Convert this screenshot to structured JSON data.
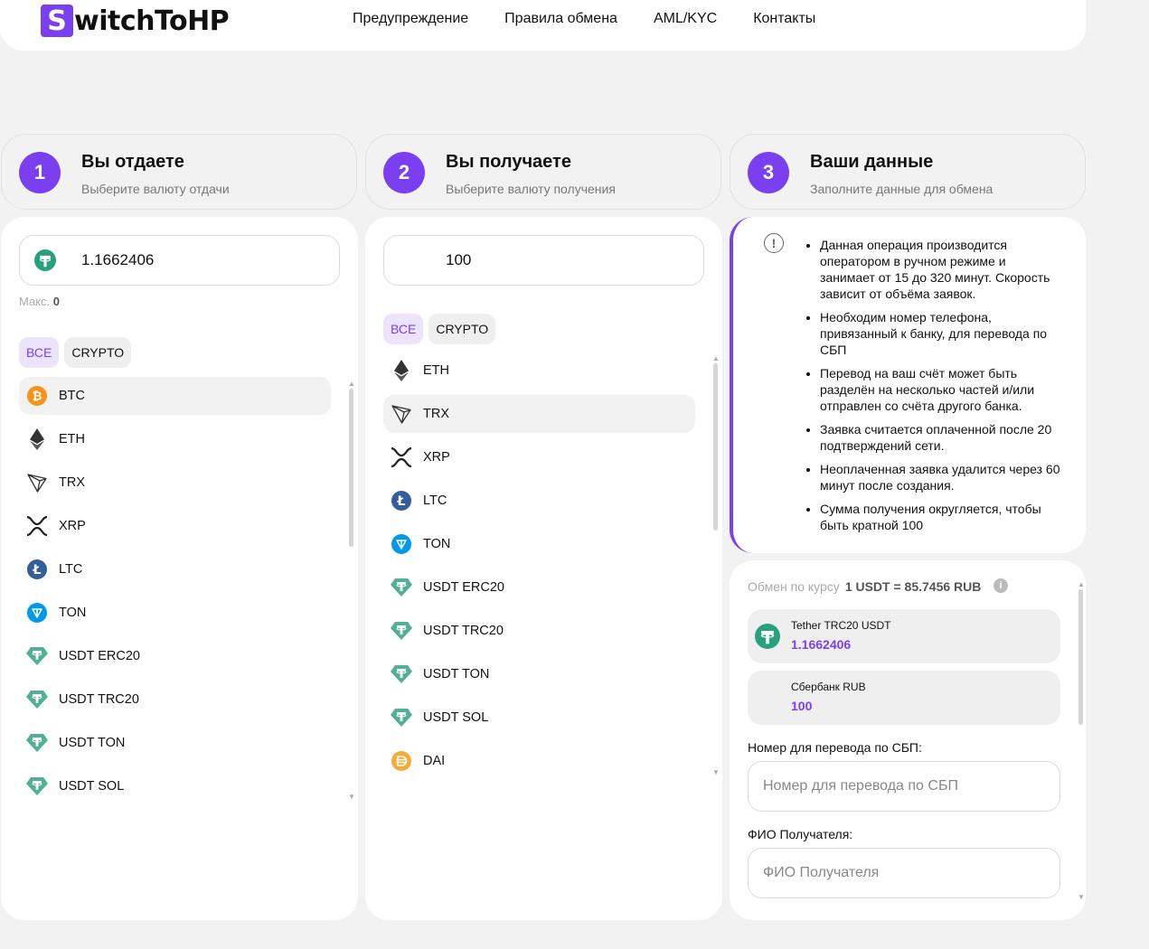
{
  "header": {
    "logo_letter": "S",
    "logo_text": "witchToHP",
    "nav": [
      "Предупреждение",
      "Правила обмена",
      "AML/KYC",
      "Контакты"
    ]
  },
  "steps": [
    {
      "num": "1",
      "title": "Вы отдаете",
      "subtitle": "Выберите валюту отдачи"
    },
    {
      "num": "2",
      "title": "Вы получаете",
      "subtitle": "Выберите валюту получения"
    },
    {
      "num": "3",
      "title": "Ваши данные",
      "subtitle": "Заполните данные для обмена"
    }
  ],
  "give": {
    "amount": "1.1662406",
    "max_label": "Макс.",
    "max_value": "0",
    "filters": [
      "ВСЕ",
      "CRYPTO"
    ],
    "currencies": [
      "BTC",
      "ETH",
      "TRX",
      "XRP",
      "LTC",
      "TON",
      "USDT ERC20",
      "USDT TRC20",
      "USDT TON",
      "USDT SOL"
    ],
    "selected": "BTC"
  },
  "receive": {
    "amount": "100",
    "filters": [
      "ВСЕ",
      "CRYPTO"
    ],
    "currencies": [
      "ETH",
      "TRX",
      "XRP",
      "LTC",
      "TON",
      "USDT ERC20",
      "USDT TRC20",
      "USDT TON",
      "USDT SOL",
      "DAI"
    ],
    "selected": "TRX"
  },
  "info": {
    "icon": "!",
    "notes": [
      "Данная операция производится оператором в ручном режиме и занимает от 15 до 320 минут. Скорость зависит от объёма заявок.",
      "Необходим номер телефона, привязанный к банку, для перевода по СБП",
      "Перевод на ваш счёт может быть разделён на несколько частей и/или отправлен со счёта другого банка.",
      "Заявка считается оплаченной после 20 подтверждений сети.",
      "Неоплаченная заявка удалится через 60 минут после создания.",
      "Сумма получения округляется, чтобы быть кратной 100"
    ]
  },
  "exchange": {
    "rate_label": "Обмен по курсу",
    "rate_value": "1 USDT = 85.7456 RUB",
    "from_name": "Tether TRC20 USDT",
    "from_value": "1.1662406",
    "to_name": "Сбербанк RUB",
    "to_value": "100",
    "sbp_label": "Номер для перевода по СБП:",
    "sbp_placeholder": "Номер для перевода по СБП",
    "fio_label": "ФИО Получателя:",
    "fio_placeholder": "ФИО Получателя"
  },
  "colors": {
    "accent": "#7b3ff2",
    "tether": "#26a17b",
    "btc": "#f7931a",
    "ltc": "#345d9d",
    "ton": "#0098ea",
    "dai": "#f5ac37"
  }
}
